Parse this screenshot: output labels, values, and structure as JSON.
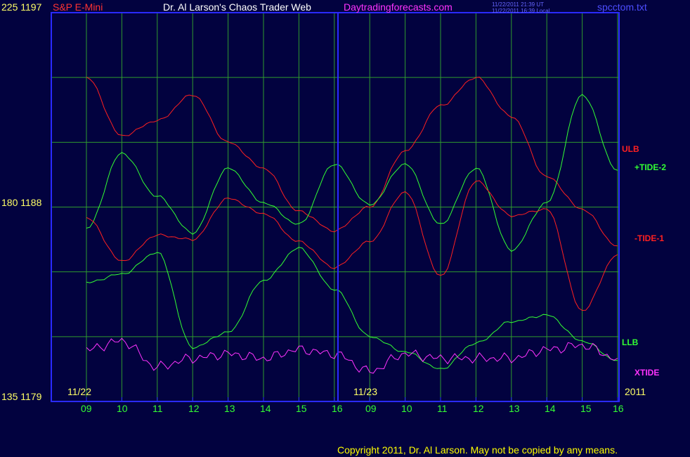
{
  "header": {
    "y_top": "225  1197",
    "symbol": "S&P E-Mini",
    "title": "Dr. Al Larson's Chaos Trader Web",
    "site": "Daytradingforecasts.com",
    "time_ut": "11/22/2011 21:39 UT",
    "time_local": "11/22/2011 16:39 Local",
    "file": "spcctom.txt"
  },
  "y_labels": {
    "mid": "180  1188",
    "bottom": "135  1179"
  },
  "date_labels": {
    "day1": "11/22",
    "day2": "11/23",
    "year": "2011"
  },
  "hour_labels": [
    "09",
    "10",
    "11",
    "12",
    "13",
    "14",
    "15",
    "16",
    "09",
    "10",
    "11",
    "12",
    "13",
    "14",
    "15",
    "16"
  ],
  "copyright": "Copyright 2011, Dr. Al Larson. May not be copied by any means.",
  "colors": {
    "background": "#02023f",
    "grid": "#2f9a2f",
    "frame": "#2a2aff",
    "tide_plus": "#33ff33",
    "tide_minus": "#ff2020",
    "xtide": "#ff33ff",
    "price_up": "#ffffff",
    "price_down": "#ff0000",
    "avg_fast": "#ffff33",
    "avg_slow": "#33ccff",
    "labels_y": "#ffff66",
    "title_text": "#ffffff",
    "site_text": "#ff33ff",
    "copyright_text": "#ffff00"
  },
  "chart_data": {
    "type": "line",
    "title": "S&P E-Mini",
    "y_left_scale": {
      "range": [
        135,
        225
      ],
      "ticks": [
        135,
        180,
        225
      ]
    },
    "y_price_scale": {
      "range": [
        1179,
        1197
      ],
      "ticks": [
        1179,
        1188,
        1197
      ]
    },
    "x_hours": [
      "09",
      "10",
      "11",
      "12",
      "13",
      "14",
      "15",
      "16",
      "09",
      "10",
      "11",
      "12",
      "13",
      "14",
      "15",
      "16"
    ],
    "x_days": [
      "11/22",
      "11/23"
    ],
    "series": [
      {
        "name": "ULB",
        "values": [
          1194.0,
          1191.3,
          1192.0,
          1193.2,
          1191.0,
          1189.8,
          1187.8,
          1186.9,
          1188.0,
          1190.6,
          1192.7,
          1194.0,
          1192.2,
          1189.4,
          1187.9,
          1186.2
        ]
      },
      {
        "name": "LLB",
        "values": [
          1184.5,
          1184.9,
          1185.9,
          1181.5,
          1182.2,
          1184.6,
          1186.1,
          1184.2,
          1182.0,
          1181.3,
          1180.5,
          1181.7,
          1182.7,
          1183.0,
          1181.8,
          1180.9
        ]
      },
      {
        "name": "+TIDE-2",
        "values": [
          1187.0,
          1190.5,
          1188.5,
          1186.8,
          1189.8,
          1188.2,
          1187.2,
          1190.0,
          1188.1,
          1190.0,
          1187.2,
          1189.8,
          1186.0,
          1188.2,
          1193.2,
          1189.7
        ]
      },
      {
        "name": "-TIDE-1",
        "values": [
          1187.5,
          1185.5,
          1186.7,
          1186.5,
          1188.4,
          1187.7,
          1186.4,
          1185.2,
          1186.4,
          1188.7,
          1184.8,
          1189.2,
          1187.6,
          1187.9,
          1183.2,
          1185.8
        ]
      },
      {
        "name": "XTIDE",
        "values": [
          147,
          149,
          143,
          145,
          146,
          145,
          147,
          146,
          142,
          146,
          145,
          145,
          145,
          147,
          148,
          145
        ]
      }
    ]
  }
}
